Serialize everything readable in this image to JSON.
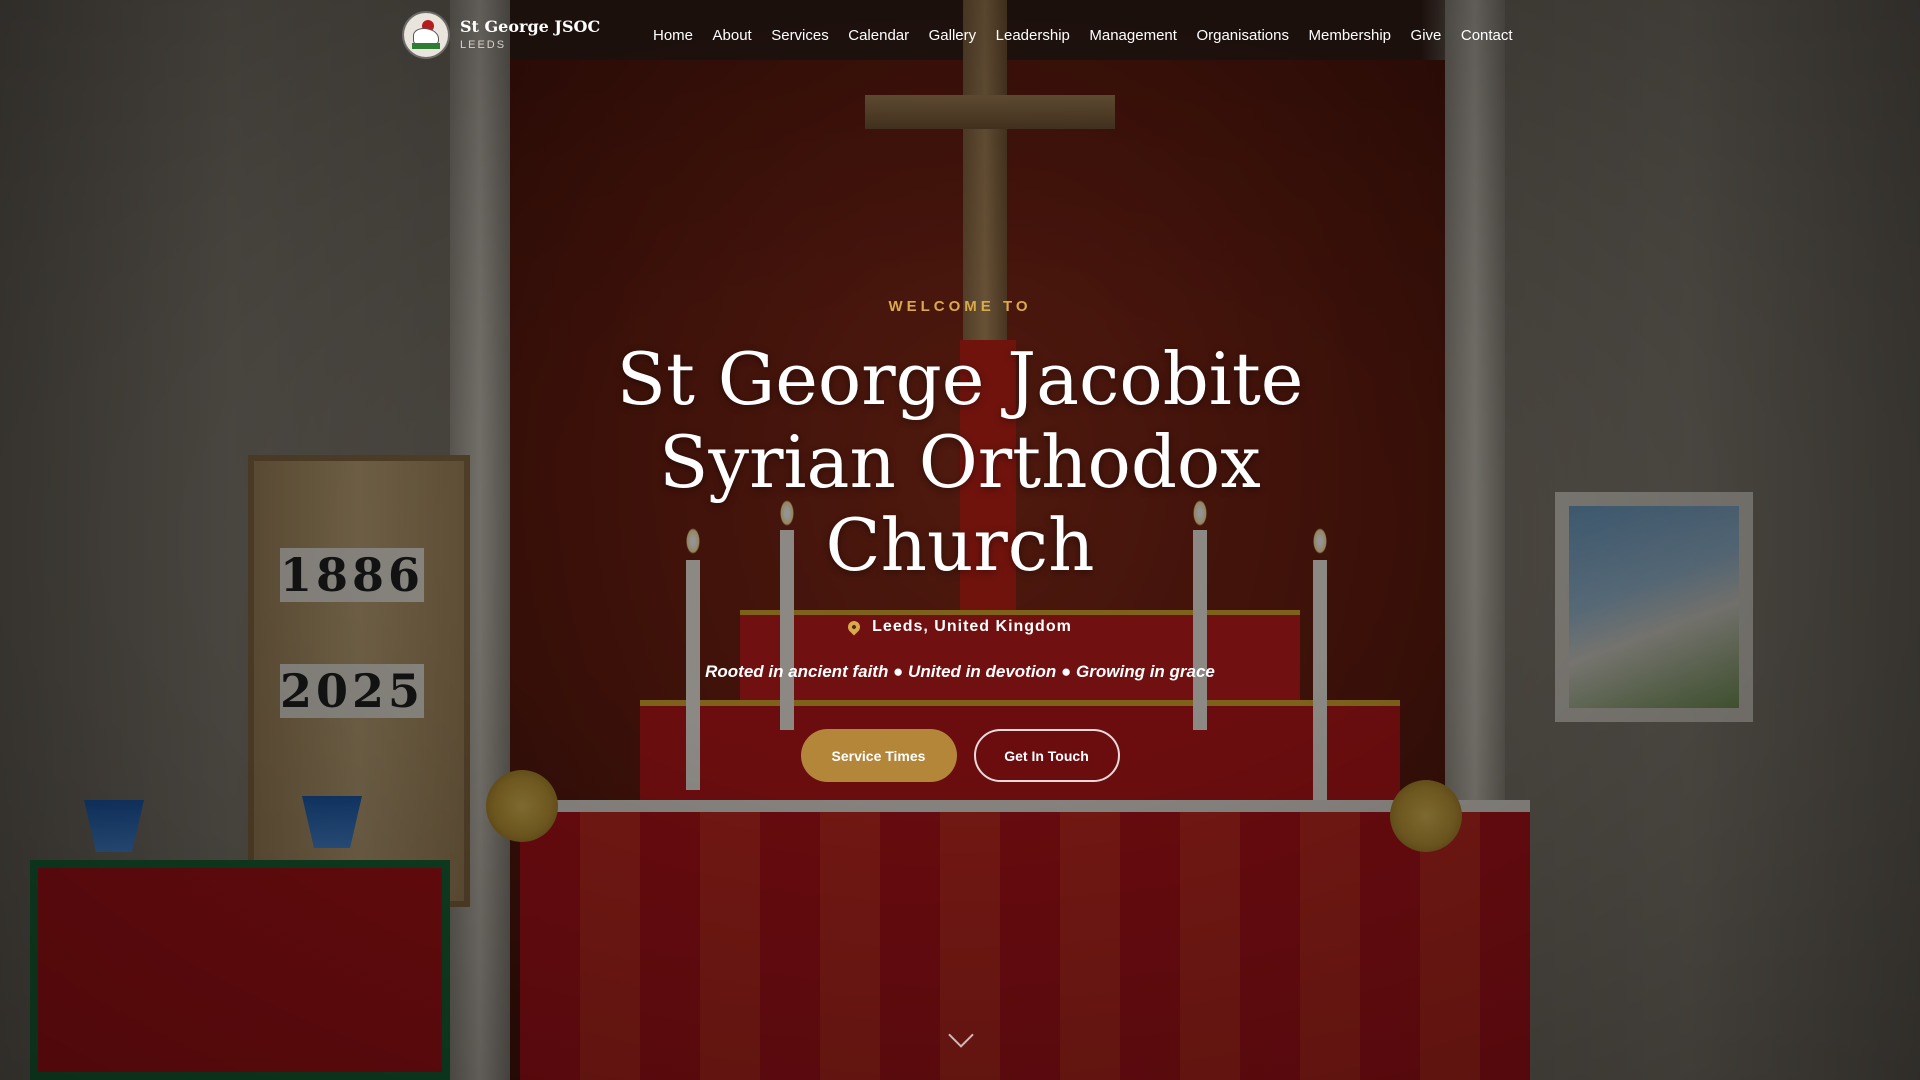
{
  "brand": {
    "name": "St George JSOC",
    "subtitle": "LEEDS",
    "logo_icon": "church-logo-icon"
  },
  "nav": {
    "items": [
      "Home",
      "About",
      "Services",
      "Calendar",
      "Gallery",
      "Leadership",
      "Management",
      "Organisations",
      "Membership",
      "Give",
      "Contact"
    ]
  },
  "hero": {
    "kicker": "WELCOME TO",
    "title": "St George Jacobite Syrian Orthodox Church",
    "location": "Leeds, United Kingdom",
    "location_icon": "map-pin-icon",
    "tagline": "Rooted in ancient faith ● United in devotion ● Growing in grace",
    "primary_button": "Service Times",
    "secondary_button": "Get In Touch",
    "scroll_icon": "chevron-down-icon"
  },
  "background": {
    "board_years": [
      "1886",
      "2025"
    ]
  },
  "colors": {
    "accent": "#d9a94a",
    "button": "#b3863a"
  }
}
